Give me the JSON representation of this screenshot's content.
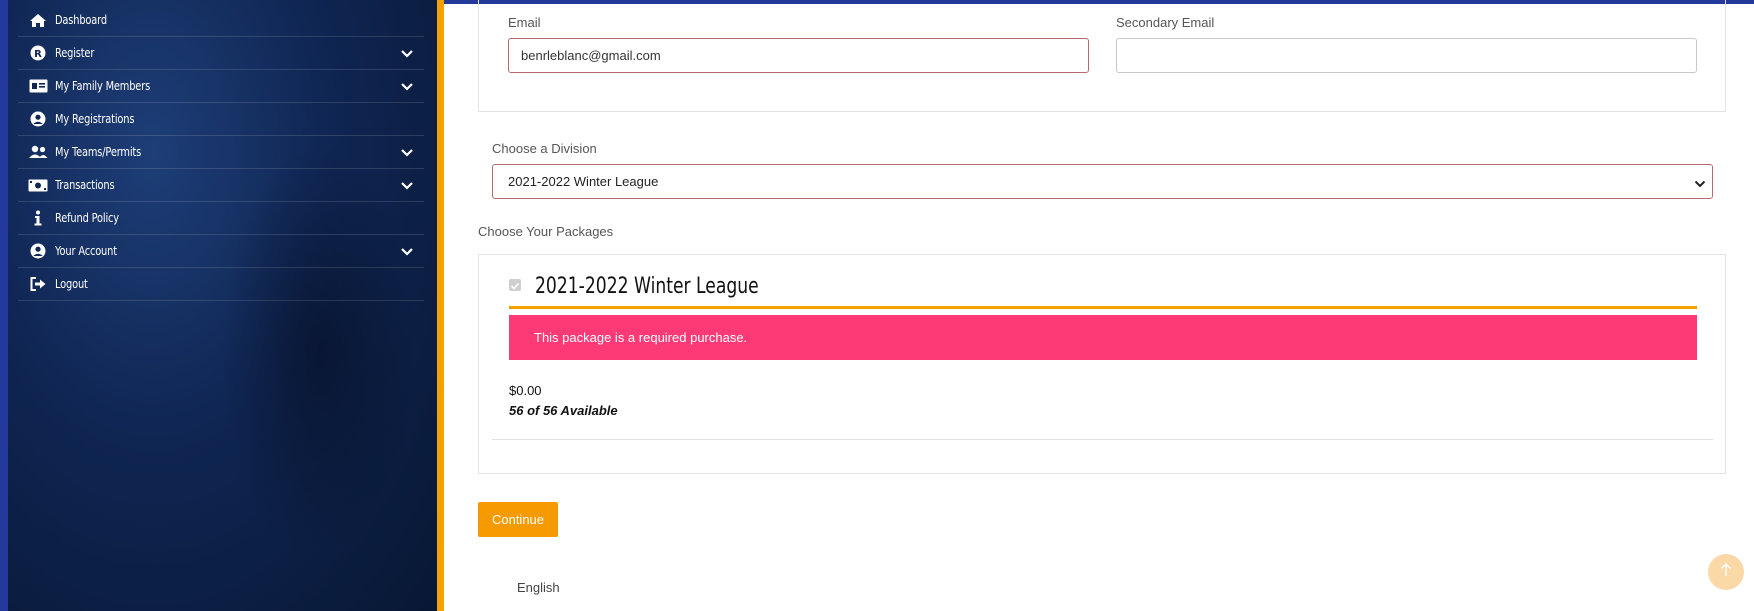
{
  "sidebar": {
    "items": [
      {
        "label": "Dashboard",
        "icon": "home-icon",
        "has_submenu": false
      },
      {
        "label": "Register",
        "icon": "register-icon",
        "has_submenu": true
      },
      {
        "label": "My Family Members",
        "icon": "id-card-icon",
        "has_submenu": true
      },
      {
        "label": "My Registrations",
        "icon": "user-circle-icon",
        "has_submenu": false
      },
      {
        "label": "My Teams/Permits",
        "icon": "users-icon",
        "has_submenu": true
      },
      {
        "label": "Transactions",
        "icon": "money-bill-icon",
        "has_submenu": true
      },
      {
        "label": "Refund Policy",
        "icon": "info-icon",
        "has_submenu": false
      },
      {
        "label": "Your Account",
        "icon": "user-circle-icon",
        "has_submenu": true
      },
      {
        "label": "Logout",
        "icon": "logout-icon",
        "has_submenu": false
      }
    ]
  },
  "form": {
    "email_label": "Email",
    "email_value": "benrleblanc@gmail.com",
    "secondary_email_label": "Secondary Email",
    "secondary_email_value": "",
    "division_label": "Choose a Division",
    "division_selected": "2021-2022 Winter League"
  },
  "packages": {
    "section_label": "Choose Your Packages",
    "title": "2021-2022 Winter League",
    "alert": "This package is a required purchase.",
    "price": "$0.00",
    "availability": "56 of 56 Available"
  },
  "actions": {
    "continue_label": "Continue"
  },
  "footer": {
    "language": "English"
  },
  "colors": {
    "accent": "#f5a100",
    "alert": "#fe3a76",
    "sidebar": "#0f2552",
    "top_bar": "#233a9c"
  }
}
